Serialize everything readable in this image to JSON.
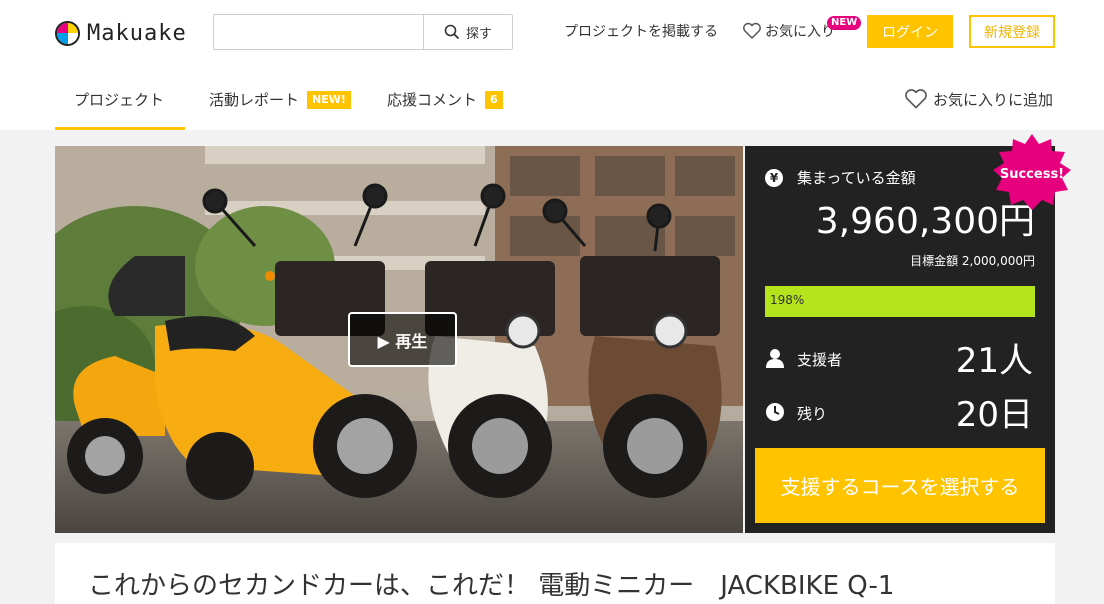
{
  "brand": {
    "name": "Makuake"
  },
  "search": {
    "placeholder": "",
    "button_label": "探す"
  },
  "header_nav": {
    "post_project": "プロジェクトを掲載する",
    "favorites": "お気に入り",
    "favorites_badge": "NEW",
    "login": "ログイン",
    "signup": "新規登録"
  },
  "tabs": [
    {
      "label": "プロジェクト",
      "badge": ""
    },
    {
      "label": "活動レポート",
      "badge": "NEW!"
    },
    {
      "label": "応援コメント",
      "badge": "6"
    }
  ],
  "add_favorite": "お気に入りに追加",
  "video": {
    "play_label": "▶ 再生"
  },
  "stats": {
    "raised_label": "集まっている金額",
    "raised_amount": "3,960,300円",
    "goal": "目標金額 2,000,000円",
    "progress_text": "198%",
    "progress_ratio": 1.0,
    "backers_label": "支援者",
    "backers_value": "21人",
    "remaining_label": "残り",
    "remaining_value": "20日",
    "cta": "支援するコースを選択する",
    "status_badge": "Success!"
  },
  "project": {
    "title": "これからのセカンドカーは、これだ！ 電動ミニカー　JACKBIKE Q-1"
  },
  "colors": {
    "accent": "#ffc300",
    "pink": "#e6007e",
    "progress": "#b4e41c",
    "panel": "#222222"
  }
}
